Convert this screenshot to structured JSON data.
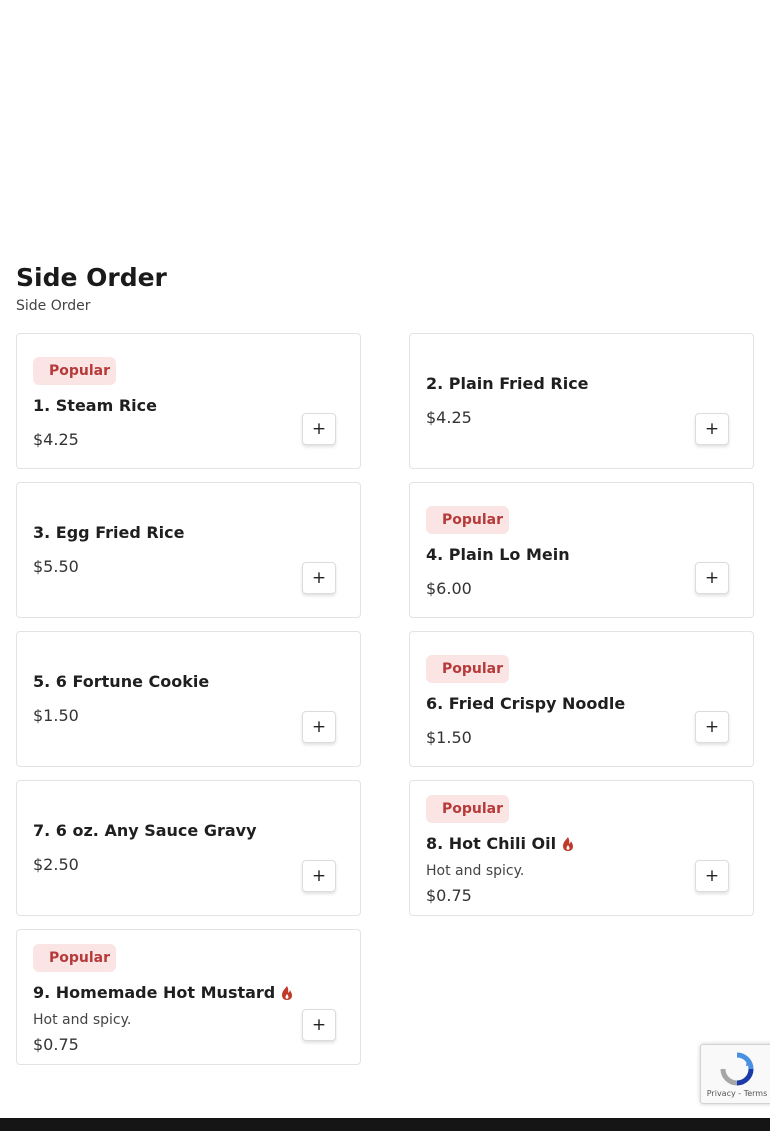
{
  "section": {
    "title": "Side Order",
    "subtitle": "Side Order"
  },
  "items": [
    {
      "name": "1. Steam Rice",
      "price": "$4.25",
      "popular": true,
      "spicy": false,
      "description": ""
    },
    {
      "name": "2. Plain Fried Rice",
      "price": "$4.25",
      "popular": false,
      "spicy": false,
      "description": ""
    },
    {
      "name": "3. Egg Fried Rice",
      "price": "$5.50",
      "popular": false,
      "spicy": false,
      "description": ""
    },
    {
      "name": "4. Plain Lo Mein",
      "price": "$6.00",
      "popular": true,
      "spicy": false,
      "description": ""
    },
    {
      "name": "5. 6 Fortune Cookie",
      "price": "$1.50",
      "popular": false,
      "spicy": false,
      "description": ""
    },
    {
      "name": "6. Fried Crispy Noodle",
      "price": "$1.50",
      "popular": true,
      "spicy": false,
      "description": ""
    },
    {
      "name": "7. 6 oz. Any Sauce Gravy",
      "price": "$2.50",
      "popular": false,
      "spicy": false,
      "description": ""
    },
    {
      "name": "8. Hot Chili Oil",
      "price": "$0.75",
      "popular": true,
      "spicy": true,
      "description": "Hot and spicy."
    },
    {
      "name": "9. Homemade Hot Mustard",
      "price": "$0.75",
      "popular": true,
      "spicy": true,
      "description": "Hot and spicy."
    }
  ],
  "labels": {
    "popular_badge": "Popular",
    "popular_icon": "",
    "add_button": "+"
  },
  "icons": {
    "popular": "popular-icon",
    "spicy": "chili-pepper-icon",
    "add": "plus-icon"
  },
  "colors": {
    "badge_bg": "#fbe4e4",
    "badge_text": "#b73a3a",
    "spicy": "#c0392b",
    "footer": "#151515"
  },
  "recaptcha": {
    "links": "Privacy - Terms"
  }
}
